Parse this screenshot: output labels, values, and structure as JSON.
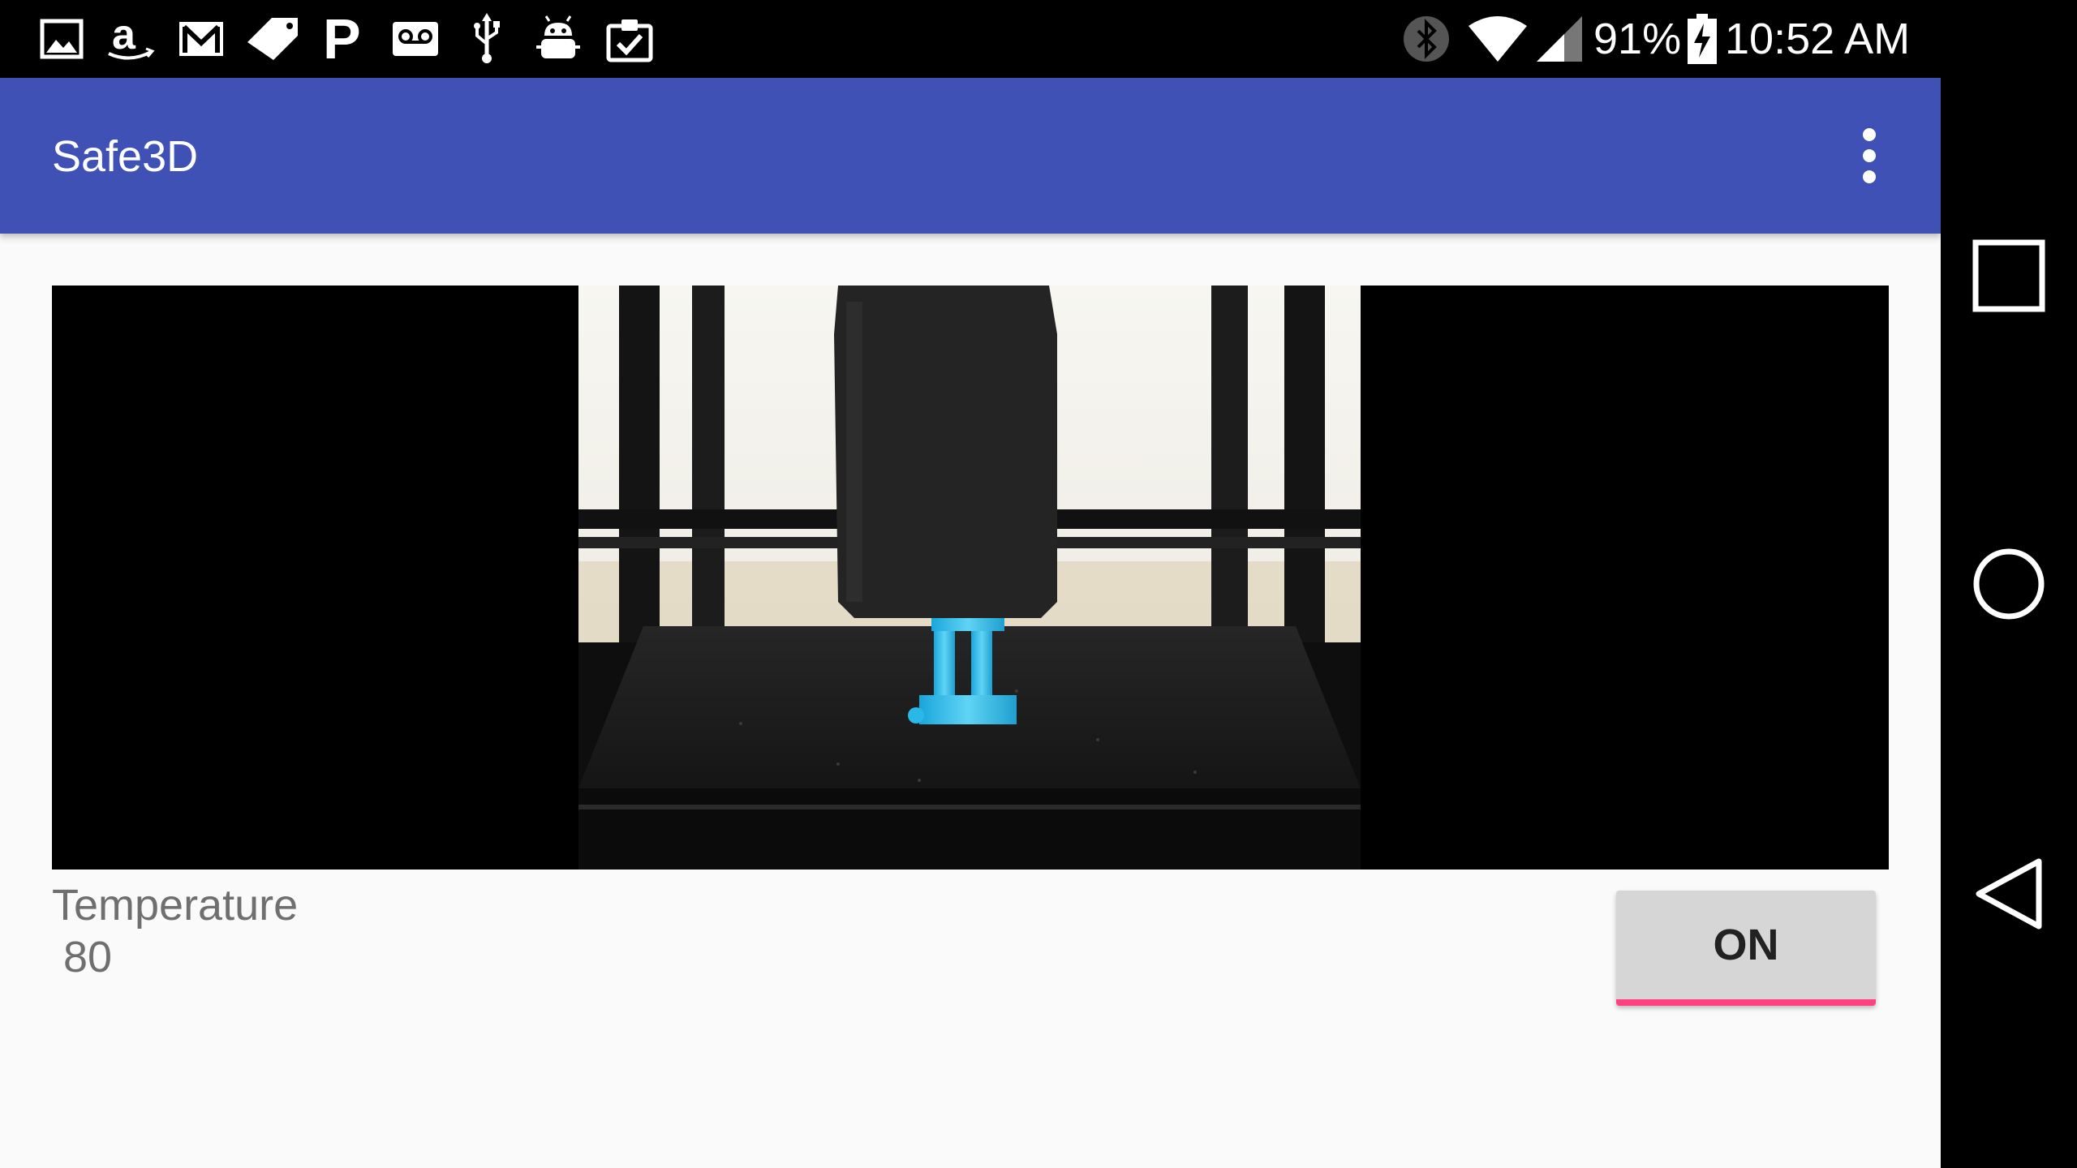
{
  "status_bar": {
    "left_icons": [
      "gallery-icon",
      "amazon-icon",
      "gmail-icon",
      "tag-icon",
      "pandora-icon",
      "voicemail-icon",
      "usb-icon",
      "android-debug-icon",
      "clipboard-check-icon"
    ],
    "right_icons": [
      "bluetooth-icon",
      "wifi-icon",
      "cell-signal-icon",
      "battery-charging-icon"
    ],
    "battery_percent": "91%",
    "time": "10:52 AM"
  },
  "app_bar": {
    "title": "Safe3D",
    "overflow_icon": "more-vert-icon"
  },
  "camera_feed": {
    "description_icon": "printer-camera-feed"
  },
  "temperature": {
    "label": "Temperature",
    "value": "80"
  },
  "toggle_button": {
    "label": "ON",
    "accent_color": "#ff4081"
  },
  "navigation_bar": {
    "buttons": [
      "recents-square-icon",
      "home-circle-icon",
      "back-triangle-icon"
    ]
  },
  "colors": {
    "app_bar": "#3f51b5",
    "background": "#fafafa",
    "status_bar": "#000000",
    "print_filament": "#2ab8e8"
  }
}
